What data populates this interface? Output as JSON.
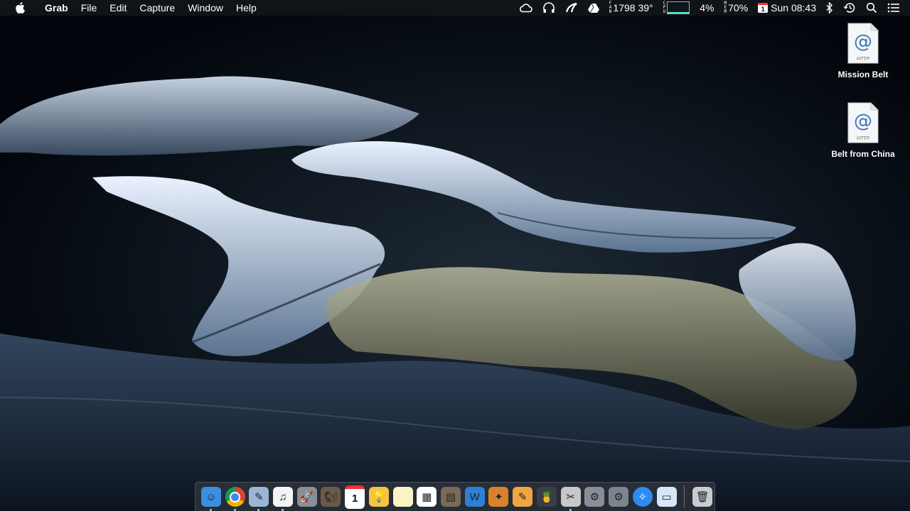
{
  "menubar": {
    "apple_icon": "apple-logo-icon",
    "menus": [
      "Grab",
      "File",
      "Edit",
      "Capture",
      "Window",
      "Help"
    ],
    "status": {
      "cpu_top": "CPU",
      "fan_speed": "1798",
      "temperature": "39°",
      "cpu_percent": "4%",
      "mem_percent": "70%",
      "calendar_day": "1",
      "clock": "Sun 08:43"
    },
    "status_icons": [
      "creative-cloud-icon",
      "headphones-icon",
      "drive-sync-icon",
      "google-drive-icon",
      "bluetooth-icon",
      "time-machine-icon",
      "spotlight-search-icon",
      "notification-center-icon"
    ]
  },
  "desktop_icons": [
    {
      "label": "Mission Belt",
      "badge": "HTTP"
    },
    {
      "label": "Belt from China",
      "badge": "HTTP"
    }
  ],
  "dock": {
    "items": [
      {
        "name": "Finder",
        "glyph": "☺",
        "color": "#3a8fe0",
        "running": true
      },
      {
        "name": "Chrome",
        "glyph": "",
        "color": "#ffffff",
        "running": true
      },
      {
        "name": "Preview",
        "glyph": "✎",
        "color": "#9bb6d4",
        "running": true
      },
      {
        "name": "iTunes",
        "glyph": "♫",
        "color": "#f5f5f7",
        "running": true
      },
      {
        "name": "Launchpad",
        "glyph": "🚀",
        "color": "#8a8f97",
        "running": false
      },
      {
        "name": "Cyberduck",
        "glyph": "🐿",
        "color": "#6b5a4a",
        "running": false
      },
      {
        "name": "Calendar",
        "glyph": "1",
        "color": "#ffffff",
        "running": false
      },
      {
        "name": "Keep",
        "glyph": "💡",
        "color": "#f6c342",
        "running": false
      },
      {
        "name": "Stickies",
        "glyph": "",
        "color": "#fbf3c2",
        "running": false
      },
      {
        "name": "Launcher",
        "glyph": "▦",
        "color": "#ffffff",
        "running": false
      },
      {
        "name": "Librarian",
        "glyph": "▤",
        "color": "#7b6a58",
        "running": false
      },
      {
        "name": "Wunderbucket",
        "glyph": "W",
        "color": "#2f7fd6",
        "running": false
      },
      {
        "name": "Photo Editor",
        "glyph": "✦",
        "color": "#d9822b",
        "running": false
      },
      {
        "name": "Pages",
        "glyph": "✎",
        "color": "#f0a640",
        "running": false
      },
      {
        "name": "Cocktail",
        "glyph": "🍍",
        "color": "#3a3f46",
        "running": false
      },
      {
        "name": "Grab",
        "glyph": "✂",
        "color": "#c8c8c8",
        "running": true
      },
      {
        "name": "Utility",
        "glyph": "⚙",
        "color": "#8a8f97",
        "running": false
      },
      {
        "name": "System Preferences",
        "glyph": "⚙",
        "color": "#7e848c",
        "running": false
      },
      {
        "name": "Safari",
        "glyph": "✧",
        "color": "#2d8cf0",
        "running": false
      },
      {
        "name": "Scanner",
        "glyph": "▭",
        "color": "#d6e8f8",
        "running": false
      },
      {
        "name": "Trash",
        "glyph": "🗑",
        "color": "#c8ccd0",
        "running": false
      }
    ]
  }
}
